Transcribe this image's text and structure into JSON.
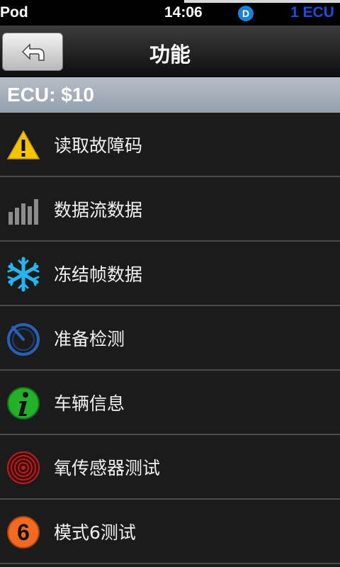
{
  "status": {
    "carrier": "Pod",
    "time": "14:06",
    "indicator": "D",
    "ecu": "1 ECU"
  },
  "nav": {
    "title": "功能",
    "back_icon": "back-arrow-icon"
  },
  "ecu_header": "ECU: $10",
  "menu": [
    {
      "label": "读取故障码",
      "icon": "warning-icon"
    },
    {
      "label": "数据流数据",
      "icon": "bar-chart-icon"
    },
    {
      "label": "冻结帧数据",
      "icon": "snowflake-icon"
    },
    {
      "label": "准备检测",
      "icon": "gauge-icon"
    },
    {
      "label": "车辆信息",
      "icon": "info-icon"
    },
    {
      "label": "氧传感器测试",
      "icon": "sensor-icon"
    },
    {
      "label": "模式6测试",
      "icon": "mode6-icon",
      "icon_text": "6"
    }
  ],
  "colors": {
    "status_dot": "#1b82d8",
    "ecu_text": "#1e4be0",
    "warning": "#f5c400",
    "snowflake": "#25b5f0",
    "info": "#23b02a",
    "sensor": "#c21d1d",
    "mode6": "#f26a21"
  }
}
